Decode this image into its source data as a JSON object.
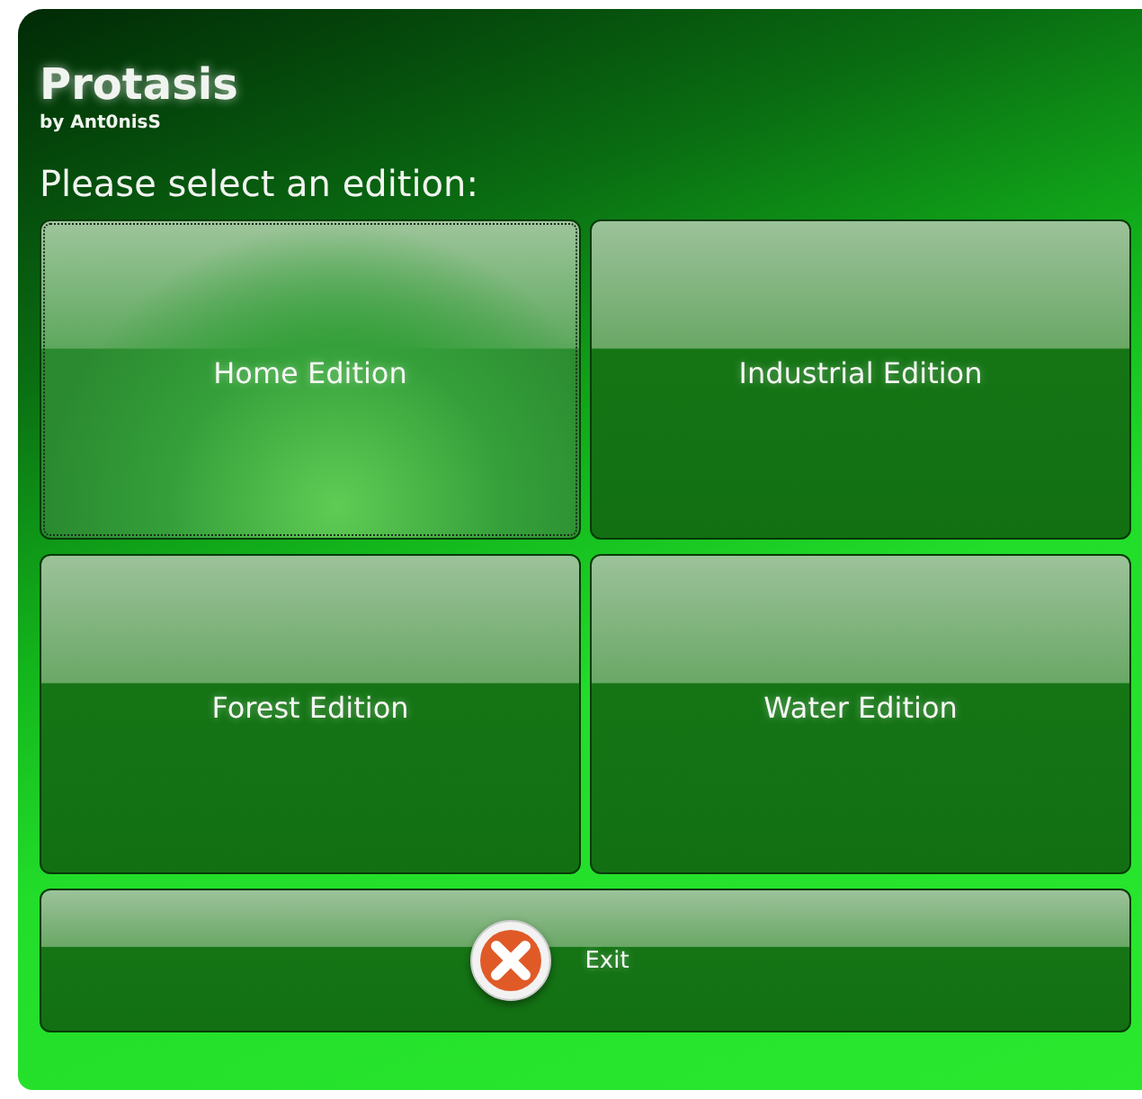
{
  "app": {
    "title": "Protasis",
    "author": "by Ant0nisS"
  },
  "prompt": "Please select an edition:",
  "editions": [
    {
      "label": "Home Edition",
      "focused": true
    },
    {
      "label": "Industrial Edition",
      "focused": false
    },
    {
      "label": "Forest Edition",
      "focused": false
    },
    {
      "label": "Water Edition",
      "focused": false
    }
  ],
  "exit_button": {
    "label": "Exit"
  }
}
